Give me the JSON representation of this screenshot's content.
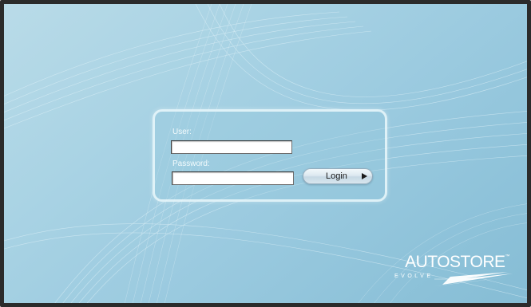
{
  "login_form": {
    "user_label": "User:",
    "user_value": "",
    "password_label": "Password:",
    "password_value": "",
    "login_button_label": "Login",
    "login_button_icon": "play-arrow-icon"
  },
  "branding": {
    "logo_text": "AUTOSTORE",
    "trademark": "™",
    "tagline": "EVOLVE",
    "logo_icon": "swoosh-icon"
  },
  "colors": {
    "frame": "#2b2b2b",
    "background": "#a9d3e4",
    "panel_border": "#ebf8fc",
    "label_text": "#f4fbfd"
  }
}
